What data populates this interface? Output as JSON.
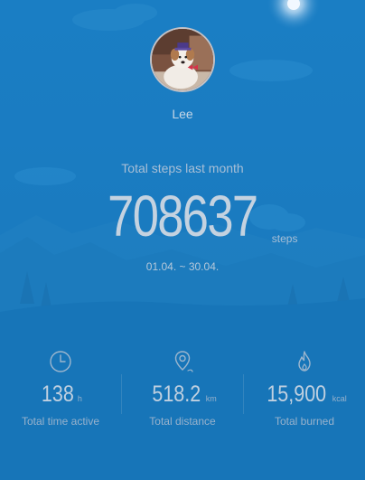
{
  "profile": {
    "name": "Lee",
    "avatar_description": "dog-with-party-hat-photo"
  },
  "summary": {
    "title": "Total steps last month",
    "steps_value": "708637",
    "steps_unit": "steps",
    "date_range": "01.04. ~ 30.04."
  },
  "stats": [
    {
      "icon": "clock-icon",
      "value": "138",
      "unit": "h",
      "label": "Total time active"
    },
    {
      "icon": "location-pin-icon",
      "value": "518.2",
      "unit": "km",
      "label": "Total distance"
    },
    {
      "icon": "flame-icon",
      "value": "15,900",
      "unit": "kcal",
      "label": "Total burned"
    }
  ],
  "colors": {
    "background": "#1878bc",
    "text_primary": "#c4d2e0",
    "text_secondary": "#a8bfd6"
  }
}
